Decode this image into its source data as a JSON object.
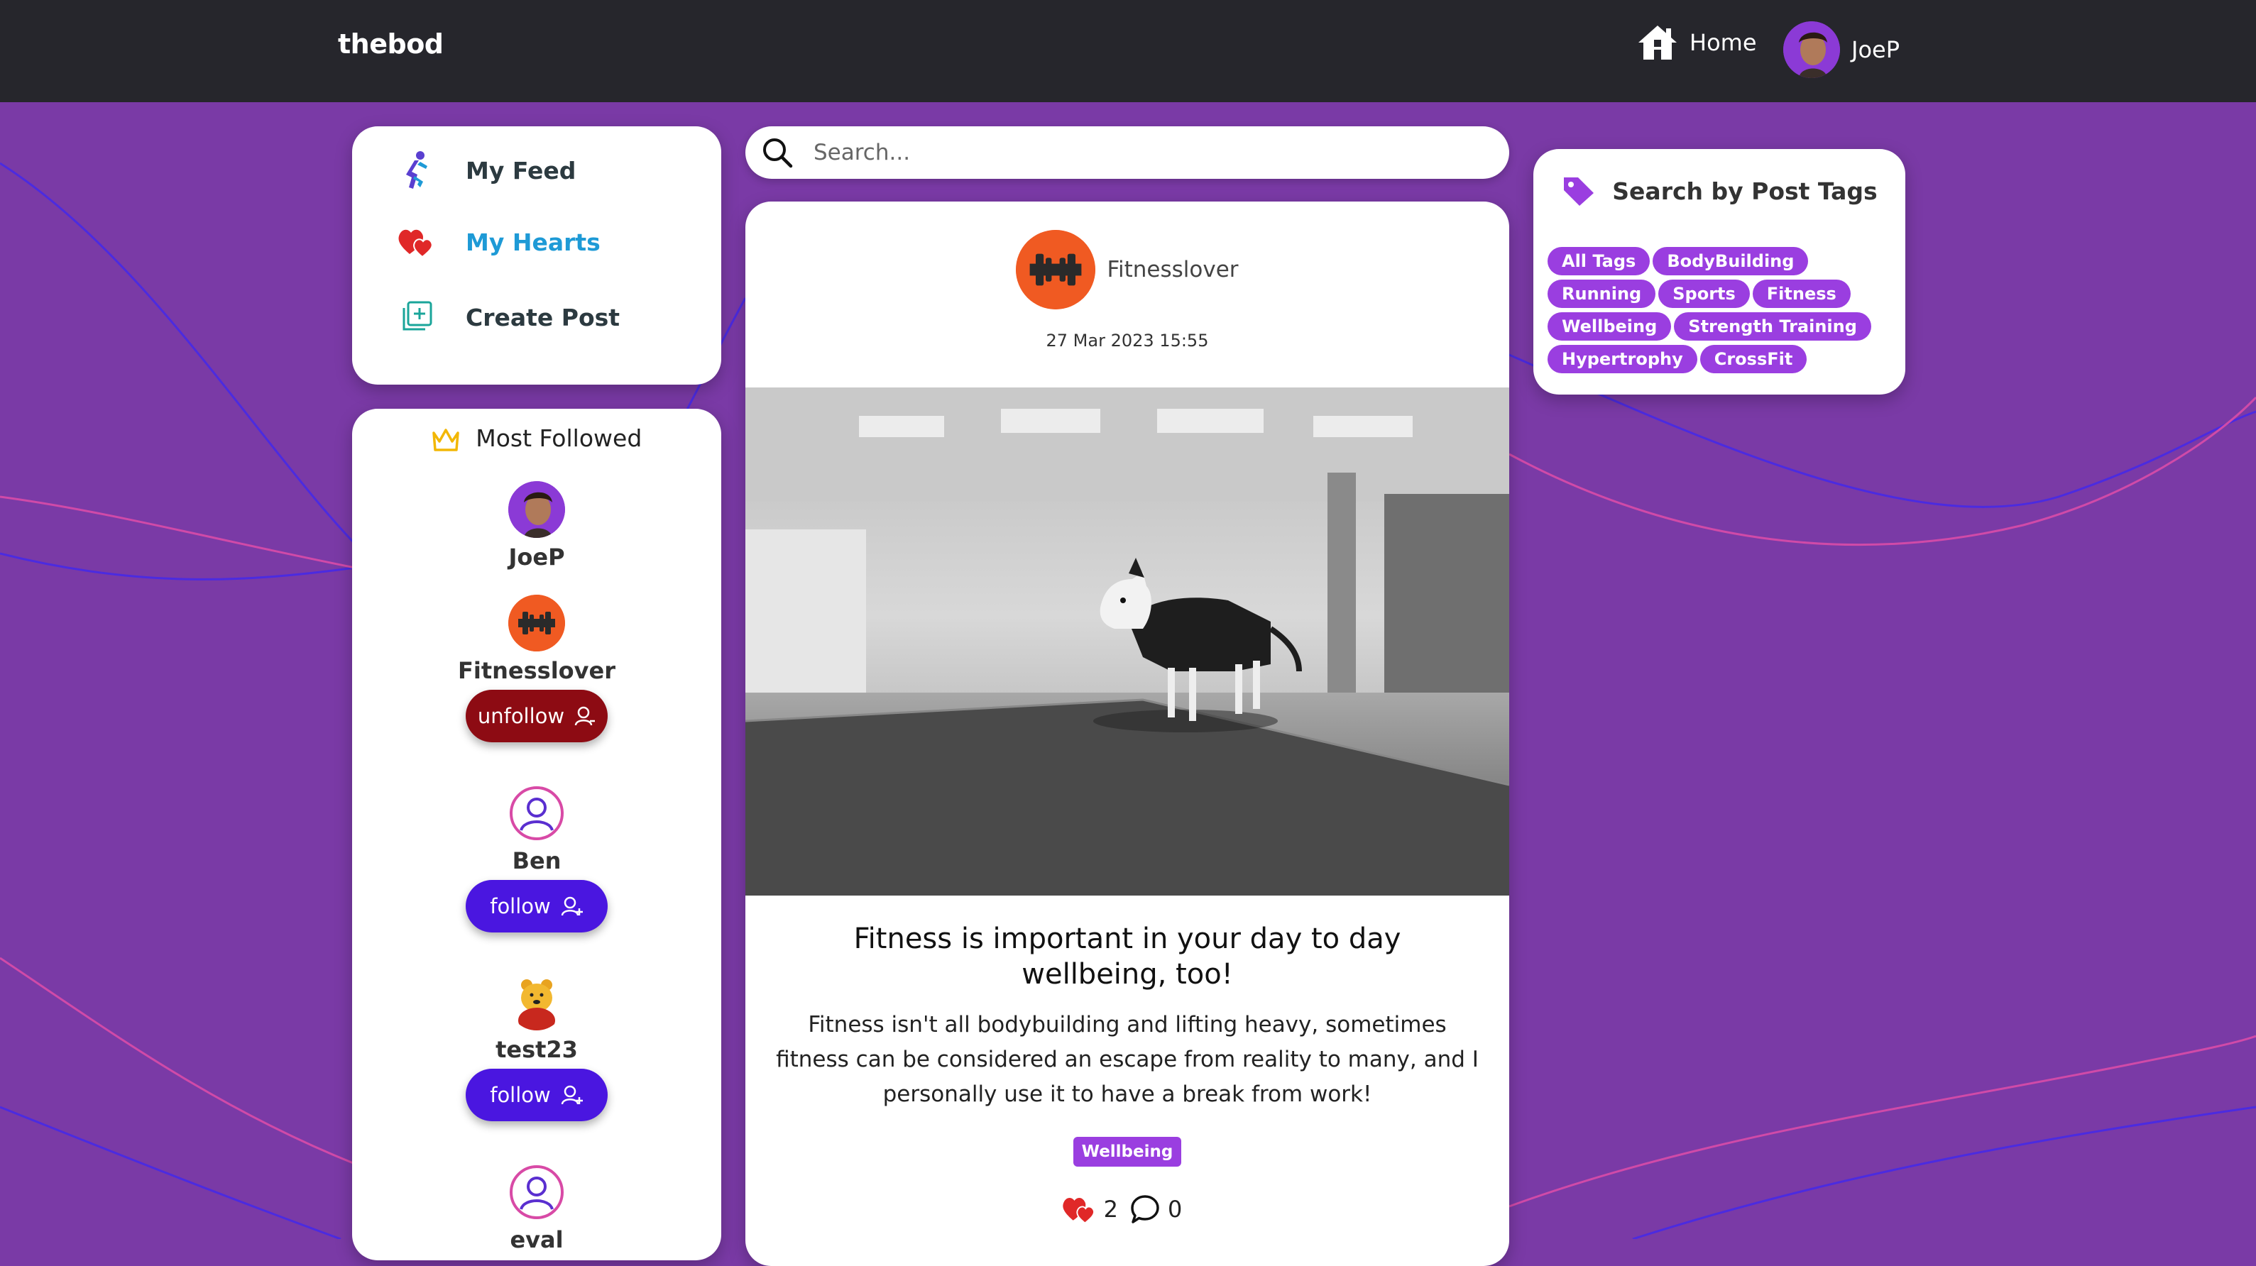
{
  "header": {
    "brand": "thebod",
    "home_label": "Home",
    "username": "JoeP"
  },
  "nav": {
    "items": [
      {
        "label": "My Feed",
        "icon": "runner-icon"
      },
      {
        "label": "My Hearts",
        "icon": "hearts-icon",
        "active": true
      },
      {
        "label": "Create Post",
        "icon": "add-post-icon"
      }
    ]
  },
  "most_followed": {
    "title": "Most Followed",
    "users": [
      {
        "name": "JoeP",
        "avatar": "photo",
        "action": ""
      },
      {
        "name": "Fitnesslover",
        "avatar": "dumbbell-icon",
        "action": "unfollow"
      },
      {
        "name": "Ben",
        "avatar": "user-icon",
        "action": "follow"
      },
      {
        "name": "test23",
        "avatar": "bear-icon",
        "action": "follow"
      },
      {
        "name": "eval",
        "avatar": "user-icon",
        "action": ""
      }
    ]
  },
  "search": {
    "placeholder": "Search..."
  },
  "post": {
    "author": "Fitnesslover",
    "date": "27 Mar 2023 15:55",
    "title": "Fitness is important in your day to day wellbeing, too!",
    "body": "Fitness isn't all bodybuilding and lifting heavy, sometimes fitness can be considered an escape from reality to many, and I personally use it to have a break from work!",
    "tag": "Wellbeing",
    "hearts": "2",
    "comments": "0"
  },
  "tags_panel": {
    "title": "Search by Post Tags",
    "tags": [
      "All Tags",
      "BodyBuilding",
      "Running",
      "Sports",
      "Fitness",
      "Wellbeing",
      "Strength Training",
      "Hypertrophy",
      "CrossFit"
    ]
  },
  "colors": {
    "background": "#7a3aa6",
    "topbar": "#26262c",
    "tag_purple": "#9a3ee0",
    "follow_blue": "#4a16e0",
    "unfollow_red": "#8d0b13",
    "active_link": "#1e9ad6",
    "avatar_orange": "#f05a22"
  }
}
